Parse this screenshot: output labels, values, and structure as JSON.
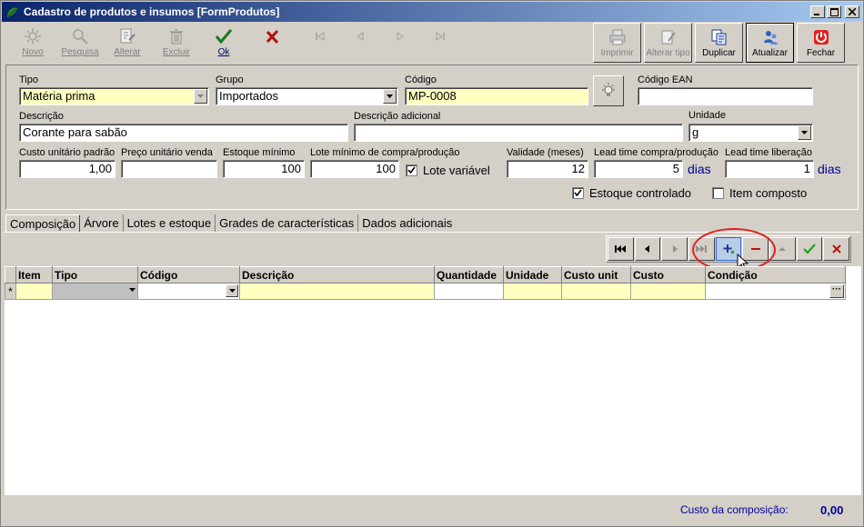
{
  "window": {
    "title": "Cadastro de produtos e insumos [FormProdutos]"
  },
  "toolbar": {
    "novo": "Novo",
    "pesquisa": "Pesquisa",
    "alterar": "Alterar",
    "excluir": "Excluir",
    "ok": "Ok",
    "imprimir": "Imprimir",
    "alterar_tipo": "Alterar tipo",
    "duplicar": "Duplicar",
    "atualizar": "Atualizar",
    "fechar": "Fechar"
  },
  "form": {
    "tipo_label": "Tipo",
    "tipo_value": "Matéria prima",
    "grupo_label": "Grupo",
    "grupo_value": "Importados",
    "codigo_label": "Código",
    "codigo_value": "MP-0008",
    "codigo_ean_label": "Código EAN",
    "codigo_ean_value": "",
    "descricao_label": "Descrição",
    "descricao_value": "Corante para sabão",
    "descricao_adicional_label": "Descrição adicional",
    "descricao_adicional_value": "",
    "unidade_label": "Unidade",
    "unidade_value": "g",
    "custo_unitario_label": "Custo unitário padrão",
    "custo_unitario_value": "1,00",
    "preco_unitario_label": "Preço unitário venda",
    "preco_unitario_value": "",
    "estoque_minimo_label": "Estoque mínimo",
    "estoque_minimo_value": "100",
    "lote_minimo_label": "Lote mínimo de compra/produção",
    "lote_minimo_value": "100",
    "lote_variavel_label": "Lote variável",
    "validade_label": "Validade (meses)",
    "validade_value": "12",
    "lead_compra_label": "Lead time compra/produção",
    "lead_compra_value": "5",
    "lead_liberacao_label": "Lead time liberação",
    "lead_liberacao_value": "1",
    "dias_unit": "dias",
    "estoque_controlado_label": "Estoque controlado",
    "item_composto_label": "Item composto"
  },
  "tabs": [
    {
      "label": "Composição"
    },
    {
      "label": "Árvore"
    },
    {
      "label": "Lotes e estoque"
    },
    {
      "label": "Grades de características"
    },
    {
      "label": "Dados adicionais"
    }
  ],
  "grid": {
    "columns": [
      "Item",
      "Tipo",
      "Código",
      "Descrição",
      "Quantidade",
      "Unidade",
      "Custo unit",
      "Custo",
      "Condição"
    ],
    "new_row_marker": "*"
  },
  "footer": {
    "custo_composicao_label": "Custo da composição:",
    "custo_composicao_value": "0,00"
  }
}
